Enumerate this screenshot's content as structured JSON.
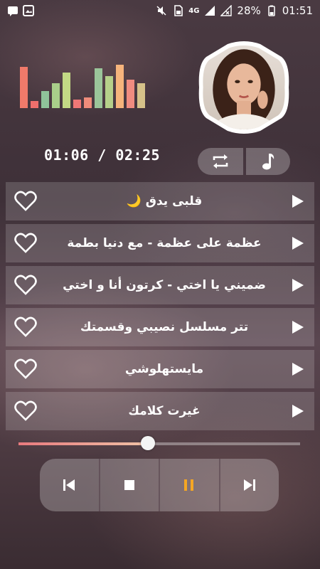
{
  "status_bar": {
    "network": "4G",
    "battery": "28%",
    "clock": "01:51"
  },
  "player": {
    "time_display": "01:06 / 02:25",
    "progress": 0.46,
    "equalizer": {
      "levels": [
        0.9,
        0.16,
        0.38,
        0.55,
        0.78,
        0.18,
        0.24,
        0.88,
        0.7,
        0.95,
        0.62,
        0.55
      ],
      "colors": [
        "#f07a6a",
        "#ee6f6c",
        "#8fc39a",
        "#a9cf8a",
        "#c3d985",
        "#ef7776",
        "#ef8c7b",
        "#9bc59a",
        "#b6d08a",
        "#f6b47c",
        "#f08c80",
        "#d6c289"
      ]
    }
  },
  "songs": [
    {
      "title": "قلبى يدق 🌙"
    },
    {
      "title": "عظمة على عظمة - مع دنيا بطمة"
    },
    {
      "title": "ضميني يا اختي - كرتون أنا و اختي"
    },
    {
      "title": "تتر مسلسل نصيبي وقسمتك"
    },
    {
      "title": "مايستهلوشي"
    },
    {
      "title": "غيرت كلامك"
    }
  ],
  "colors": {
    "accent": "#f5a623",
    "seek_fill_start": "#e87a7e",
    "seek_fill_end": "#f0c2a6"
  },
  "icons": {
    "repeat": "repeat-icon",
    "music": "music-note-icon",
    "favorite": "heart-outline-icon",
    "play": "play-icon",
    "prev": "skip-previous-icon",
    "stop": "stop-icon",
    "pause": "pause-icon",
    "next": "skip-next-icon"
  }
}
